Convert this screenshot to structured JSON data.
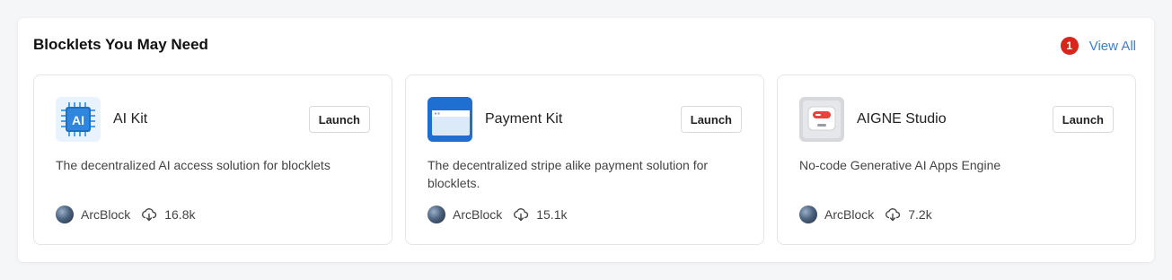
{
  "section": {
    "title": "Blocklets You May Need",
    "badge_count": "1",
    "view_all_label": "View All"
  },
  "colors": {
    "badge": "#d9261c",
    "link": "#3d7fd0"
  },
  "cards": [
    {
      "name": "AI Kit",
      "icon": "ai-kit-icon",
      "launch_label": "Launch",
      "description": "The decentralized AI access solution for blocklets",
      "author": "ArcBlock",
      "downloads": "16.8k"
    },
    {
      "name": "Payment Kit",
      "icon": "payment-kit-icon",
      "launch_label": "Launch",
      "description": "The decentralized stripe alike payment solution for blocklets.",
      "author": "ArcBlock",
      "downloads": "15.1k"
    },
    {
      "name": "AIGNE Studio",
      "icon": "aigne-studio-icon",
      "launch_label": "Launch",
      "description": "No-code Generative AI Apps Engine",
      "author": "ArcBlock",
      "downloads": "7.2k"
    }
  ]
}
